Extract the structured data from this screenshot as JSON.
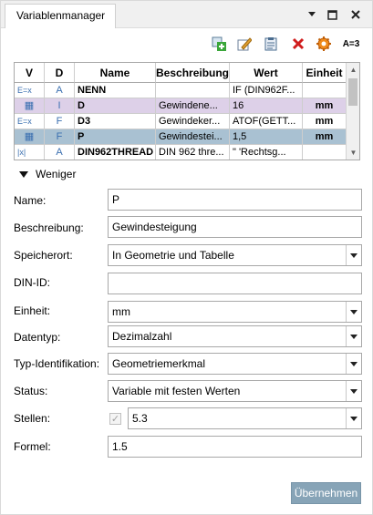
{
  "window": {
    "title": "Variablenmanager",
    "controls": {
      "dropdown": "▾",
      "restore": "☐",
      "close": "✕"
    }
  },
  "toolbar": {
    "items": [
      {
        "name": "add-variable-icon"
      },
      {
        "name": "edit-variable-icon"
      },
      {
        "name": "copy-clipboard-icon"
      },
      {
        "name": "delete-icon"
      },
      {
        "name": "settings-gear-icon"
      },
      {
        "name": "assign-icon",
        "text": "A=3"
      }
    ]
  },
  "table": {
    "columns": [
      "V",
      "D",
      "Name",
      "Beschreibung",
      "Wert",
      "Einheit"
    ],
    "rows": [
      {
        "v": "E=x",
        "d": "A",
        "name": "NENN",
        "desc": "",
        "value": "IF (DIN962F...",
        "unit": "",
        "style": ""
      },
      {
        "v": "▦",
        "d": "I",
        "name": "D",
        "desc": "Gewindene...",
        "value": "16",
        "unit": "mm",
        "style": "sel-purple"
      },
      {
        "v": "E=x",
        "d": "F",
        "name": "D3",
        "desc": "Gewindeker...",
        "value": "ATOF(GETT...",
        "unit": "mm",
        "style": ""
      },
      {
        "v": "▦",
        "d": "F",
        "name": "P",
        "desc": "Gewindestei...",
        "value": "1,5",
        "unit": "mm",
        "style": "sel-blue"
      },
      {
        "v": "|x|",
        "d": "A",
        "name": "DIN962THREAD",
        "desc": "DIN 962 thre...",
        "value": "\" 'Rechtsg...",
        "unit": "",
        "style": ""
      }
    ]
  },
  "collapse": {
    "label": "Weniger"
  },
  "form": {
    "name_label": "Name:",
    "name_value": "P",
    "desc_label": "Beschreibung:",
    "desc_value": "Gewindesteigung",
    "storage_label": "Speicherort:",
    "storage_value": "In Geometrie und Tabelle",
    "din_label": "DIN-ID:",
    "din_value": "",
    "unit_label": "Einheit:",
    "unit_value": "mm",
    "type_label": "Datentyp:",
    "type_value": "Dezimalzahl",
    "typeid_label": "Typ-Identifikation:",
    "typeid_value": "Geometriemerkmal",
    "status_label": "Status:",
    "status_value": "Variable mit festen Werten",
    "digits_label": "Stellen:",
    "digits_value": "5.3",
    "digits_checked": true,
    "formula_label": "Formel:",
    "formula_value": "1.5"
  },
  "buttons": {
    "apply": "Übernehmen"
  }
}
